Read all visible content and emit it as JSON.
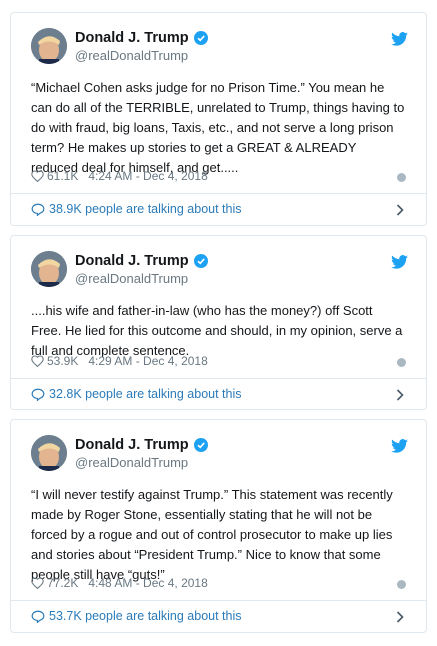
{
  "tweets": [
    {
      "name": "Donald J. Trump",
      "handle": "@realDonaldTrump",
      "text": "“Michael Cohen asks judge for no Prison Time.” You mean he can do all of the TERRIBLE, unrelated to Trump, things having to do with fraud, big loans, Taxis, etc., and not serve a long prison term? He makes up stories to get a GREAT & ALREADY reduced deal for himself, and get.....",
      "likes": "61.1K",
      "time": "4:24 AM - Dec 4, 2018",
      "talking": "38.9K people are talking about this"
    },
    {
      "name": "Donald J. Trump",
      "handle": "@realDonaldTrump",
      "text": "....his wife and father-in-law (who has the money?) off Scott Free. He lied for this outcome and should, in my opinion, serve a full and complete sentence.",
      "likes": "53.9K",
      "time": "4:29 AM - Dec 4, 2018",
      "talking": "32.8K people are talking about this"
    },
    {
      "name": "Donald J. Trump",
      "handle": "@realDonaldTrump",
      "text": "“I will never testify against Trump.” This statement was recently made by Roger Stone, essentially stating that he will not be forced by a rogue and out of control prosecutor to make up lies and stories about “President Trump.” Nice to know that some people still have “guts!”",
      "likes": "77.2K",
      "time": "4:48 AM - Dec 4, 2018",
      "talking": "53.7K people are talking about this"
    }
  ],
  "colors": {
    "link": "#2b7bb9",
    "verified": "#1da1f2",
    "muted": "#697882"
  },
  "icons": [
    "twitter-bird-icon",
    "verified-badge-icon",
    "heart-icon",
    "info-icon",
    "speech-bubble-icon",
    "chevron-right-icon"
  ]
}
